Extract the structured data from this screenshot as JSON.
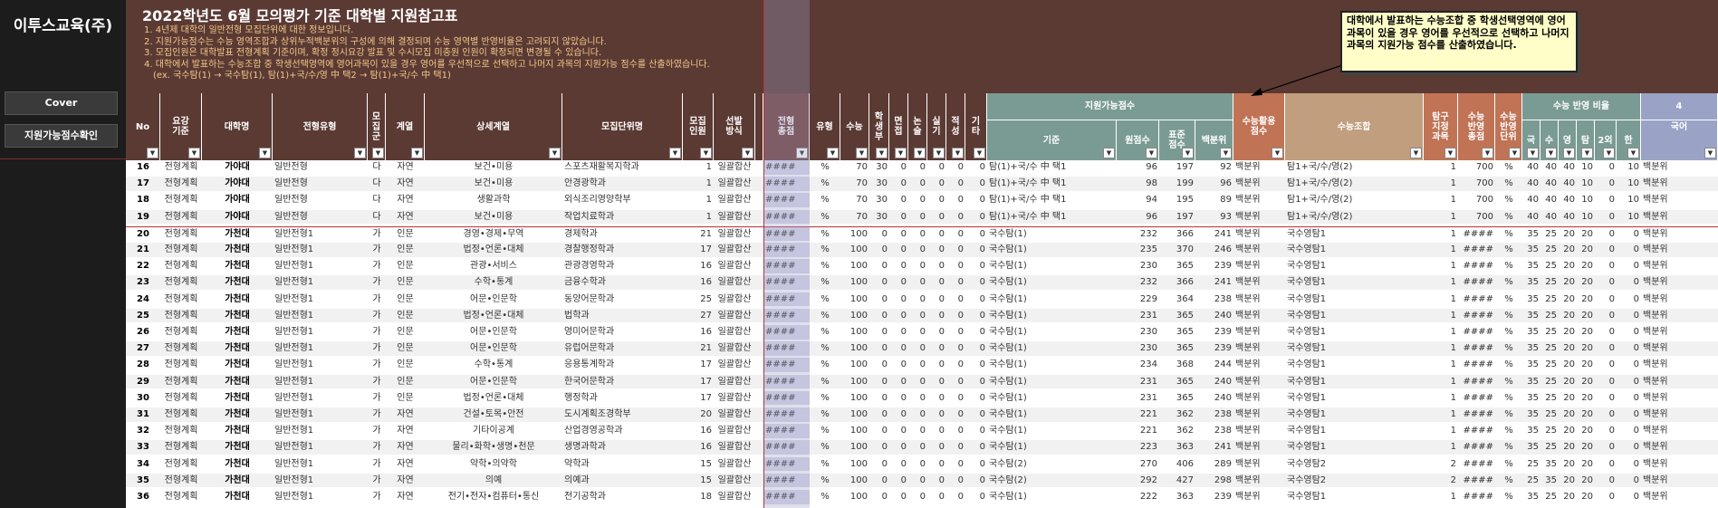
{
  "sidebar": {
    "brand": "이투스교육(주)",
    "cover_button": "Cover",
    "score_button": "지원가능점수확인"
  },
  "banner": {
    "title": "2022학년도 6월 모의평가 기준 대학별 지원참고표",
    "notes": [
      "1. 4년제 대학의 일반전형 모집단위에 대한 정보입니다.",
      "2. 지원가능점수는 수능 영역조합과 상위누적백분위의 구성에 의해 결정되며 수능 영역별 반영비율은 고려되지 않았습니다.",
      "3. 모집인원은 대학발표 전형계획 기준이며, 확정 정시요강 발표 및 수시모집 미충원 인원이 확정되면 변경될 수 있습니다.",
      "4. 대학에서 발표하는 수능조합 중 학생선택영역에 영어과목이 있을 경우 영어를 우선적으로 선택하고 나머지 과목의 지원가능 점수를 산출하였습니다.",
      "(ex. 국수탐(1) → 국수탐(1), 탐(1)+국/수/영 中 택2 → 탐(1)+국/수 中 택1)"
    ]
  },
  "callout": {
    "text": "대학에서 발표하는 수능조합 중 학생선택영역에 영어과목이 있을 경우 영어를 우선적으로 선택하고 나머지 과목의 지원가능 점수를 산출하였습니다."
  },
  "groups": {
    "score": "지원가능점수",
    "ratio": "수능 반영 비율",
    "extra": "4"
  },
  "headers": {
    "no": "No",
    "guide": "요강\n기준",
    "univ": "대학명",
    "type": "전형유형",
    "gun": "모\n집\n군",
    "field": "계열",
    "detail": "상세계열",
    "unit": "모집단위명",
    "cnt": "모집\n인원",
    "sel": "선발\n방식",
    "total": "전형\n총점",
    "kind": "유형",
    "suneung": "수능",
    "school": "학\n생\n부",
    "interview": "면\n접",
    "essay": "논\n술",
    "practical": "실\n기",
    "aptitude": "적\n성",
    "etc": "기\n타",
    "basis": "기준",
    "raw": "원점수",
    "std": "표준\n점수",
    "pct": "백분위",
    "use": "수능활용\n점수",
    "combo": "수능조합",
    "tam": "탐구\n지정\n과목",
    "tot2": "수능\n반영\n총점",
    "unit2": "수능\n반영\n단위",
    "kor": "국",
    "math": "수",
    "eng": "영",
    "tamc": "탐",
    "sec": "2외",
    "hist": "한",
    "k2": "국어"
  },
  "rows": [
    {
      "no": "16",
      "guide": "전형계획",
      "univ": "가야대",
      "type": "일반전형",
      "gun": "다",
      "field": "자연",
      "detail": "보건•미용",
      "unit": "스포츠재활복지학과",
      "cnt": "1",
      "sel": "일괄합산",
      "total": "####",
      "kind": "%",
      "sun": "70",
      "sch": "30",
      "iv": "0",
      "es": "0",
      "pr": "0",
      "ap": "0",
      "et": "0",
      "basis": "탐(1)+국/수 中 택1",
      "raw": "96",
      "std": "197",
      "pct": "92",
      "use": "백분위",
      "combo": "탐1+국/수/영(2)",
      "tam": "1",
      "tot2": "700",
      "unit2": "%",
      "kor": "40",
      "math": "40",
      "eng": "40",
      "tamc": "10",
      "sec": "0",
      "hist": "10",
      "k2": "백분위"
    },
    {
      "no": "17",
      "guide": "전형계획",
      "univ": "가야대",
      "type": "일반전형",
      "gun": "다",
      "field": "자연",
      "detail": "보건•미용",
      "unit": "안경광학과",
      "cnt": "1",
      "sel": "일괄합산",
      "total": "####",
      "kind": "%",
      "sun": "70",
      "sch": "30",
      "iv": "0",
      "es": "0",
      "pr": "0",
      "ap": "0",
      "et": "0",
      "basis": "탐(1)+국/수 中 택1",
      "raw": "98",
      "std": "199",
      "pct": "96",
      "use": "백분위",
      "combo": "탐1+국/수/영(2)",
      "tam": "1",
      "tot2": "700",
      "unit2": "%",
      "kor": "40",
      "math": "40",
      "eng": "40",
      "tamc": "10",
      "sec": "0",
      "hist": "10",
      "k2": "백분위"
    },
    {
      "no": "18",
      "guide": "전형계획",
      "univ": "가야대",
      "type": "일반전형",
      "gun": "다",
      "field": "자연",
      "detail": "생활과학",
      "unit": "외식조리영양학부",
      "cnt": "1",
      "sel": "일괄합산",
      "total": "####",
      "kind": "%",
      "sun": "70",
      "sch": "30",
      "iv": "0",
      "es": "0",
      "pr": "0",
      "ap": "0",
      "et": "0",
      "basis": "탐(1)+국/수 中 택1",
      "raw": "94",
      "std": "195",
      "pct": "89",
      "use": "백분위",
      "combo": "탐1+국/수/영(2)",
      "tam": "1",
      "tot2": "700",
      "unit2": "%",
      "kor": "40",
      "math": "40",
      "eng": "40",
      "tamc": "10",
      "sec": "0",
      "hist": "10",
      "k2": "백분위"
    },
    {
      "no": "19",
      "guide": "전형계획",
      "univ": "가야대",
      "type": "일반전형",
      "gun": "다",
      "field": "자연",
      "detail": "보건•미용",
      "unit": "작업치료학과",
      "cnt": "1",
      "sel": "일괄합산",
      "total": "####",
      "kind": "%",
      "sun": "70",
      "sch": "30",
      "iv": "0",
      "es": "0",
      "pr": "0",
      "ap": "0",
      "et": "0",
      "basis": "탐(1)+국/수 中 택1",
      "raw": "96",
      "std": "197",
      "pct": "93",
      "use": "백분위",
      "combo": "탐1+국/수/영(2)",
      "tam": "1",
      "tot2": "700",
      "unit2": "%",
      "kor": "40",
      "math": "40",
      "eng": "40",
      "tamc": "10",
      "sec": "0",
      "hist": "10",
      "k2": "백분위"
    },
    {
      "no": "20",
      "guide": "전형계획",
      "univ": "가천대",
      "type": "일반전형1",
      "gun": "가",
      "field": "인문",
      "detail": "경영•경제•무역",
      "unit": "경제학과",
      "cnt": "21",
      "sel": "일괄합산",
      "total": "####",
      "kind": "%",
      "sun": "100",
      "sch": "0",
      "iv": "0",
      "es": "0",
      "pr": "0",
      "ap": "0",
      "et": "0",
      "basis": "국수탐(1)",
      "raw": "232",
      "std": "366",
      "pct": "241",
      "use": "백분위",
      "combo": "국수영탐1",
      "tam": "1",
      "tot2": "####",
      "unit2": "%",
      "kor": "35",
      "math": "25",
      "eng": "20",
      "tamc": "20",
      "sec": "0",
      "hist": "0",
      "k2": "백분위"
    },
    {
      "no": "21",
      "guide": "전형계획",
      "univ": "가천대",
      "type": "일반전형1",
      "gun": "가",
      "field": "인문",
      "detail": "법정•언론•대체",
      "unit": "경찰행정학과",
      "cnt": "17",
      "sel": "일괄합산",
      "total": "####",
      "kind": "%",
      "sun": "100",
      "sch": "0",
      "iv": "0",
      "es": "0",
      "pr": "0",
      "ap": "0",
      "et": "0",
      "basis": "국수탐(1)",
      "raw": "235",
      "std": "370",
      "pct": "246",
      "use": "백분위",
      "combo": "국수영탐1",
      "tam": "1",
      "tot2": "####",
      "unit2": "%",
      "kor": "35",
      "math": "25",
      "eng": "20",
      "tamc": "20",
      "sec": "0",
      "hist": "0",
      "k2": "백분위"
    },
    {
      "no": "22",
      "guide": "전형계획",
      "univ": "가천대",
      "type": "일반전형1",
      "gun": "가",
      "field": "인문",
      "detail": "관광•서비스",
      "unit": "관광경영학과",
      "cnt": "16",
      "sel": "일괄합산",
      "total": "####",
      "kind": "%",
      "sun": "100",
      "sch": "0",
      "iv": "0",
      "es": "0",
      "pr": "0",
      "ap": "0",
      "et": "0",
      "basis": "국수탐(1)",
      "raw": "230",
      "std": "365",
      "pct": "239",
      "use": "백분위",
      "combo": "국수영탐1",
      "tam": "1",
      "tot2": "####",
      "unit2": "%",
      "kor": "35",
      "math": "25",
      "eng": "20",
      "tamc": "20",
      "sec": "0",
      "hist": "0",
      "k2": "백분위"
    },
    {
      "no": "23",
      "guide": "전형계획",
      "univ": "가천대",
      "type": "일반전형1",
      "gun": "가",
      "field": "인문",
      "detail": "수학•통계",
      "unit": "금융수학과",
      "cnt": "16",
      "sel": "일괄합산",
      "total": "####",
      "kind": "%",
      "sun": "100",
      "sch": "0",
      "iv": "0",
      "es": "0",
      "pr": "0",
      "ap": "0",
      "et": "0",
      "basis": "국수탐(1)",
      "raw": "232",
      "std": "366",
      "pct": "241",
      "use": "백분위",
      "combo": "국수영탐1",
      "tam": "1",
      "tot2": "####",
      "unit2": "%",
      "kor": "35",
      "math": "25",
      "eng": "20",
      "tamc": "20",
      "sec": "0",
      "hist": "0",
      "k2": "백분위"
    },
    {
      "no": "24",
      "guide": "전형계획",
      "univ": "가천대",
      "type": "일반전형1",
      "gun": "가",
      "field": "인문",
      "detail": "어문•인문학",
      "unit": "동양어문학과",
      "cnt": "25",
      "sel": "일괄합산",
      "total": "####",
      "kind": "%",
      "sun": "100",
      "sch": "0",
      "iv": "0",
      "es": "0",
      "pr": "0",
      "ap": "0",
      "et": "0",
      "basis": "국수탐(1)",
      "raw": "229",
      "std": "364",
      "pct": "238",
      "use": "백분위",
      "combo": "국수영탐1",
      "tam": "1",
      "tot2": "####",
      "unit2": "%",
      "kor": "35",
      "math": "25",
      "eng": "20",
      "tamc": "20",
      "sec": "0",
      "hist": "0",
      "k2": "백분위"
    },
    {
      "no": "25",
      "guide": "전형계획",
      "univ": "가천대",
      "type": "일반전형1",
      "gun": "가",
      "field": "인문",
      "detail": "법정•언론•대체",
      "unit": "법학과",
      "cnt": "27",
      "sel": "일괄합산",
      "total": "####",
      "kind": "%",
      "sun": "100",
      "sch": "0",
      "iv": "0",
      "es": "0",
      "pr": "0",
      "ap": "0",
      "et": "0",
      "basis": "국수탐(1)",
      "raw": "231",
      "std": "365",
      "pct": "240",
      "use": "백분위",
      "combo": "국수영탐1",
      "tam": "1",
      "tot2": "####",
      "unit2": "%",
      "kor": "35",
      "math": "25",
      "eng": "20",
      "tamc": "20",
      "sec": "0",
      "hist": "0",
      "k2": "백분위"
    },
    {
      "no": "26",
      "guide": "전형계획",
      "univ": "가천대",
      "type": "일반전형1",
      "gun": "가",
      "field": "인문",
      "detail": "어문•인문학",
      "unit": "영미어문학과",
      "cnt": "16",
      "sel": "일괄합산",
      "total": "####",
      "kind": "%",
      "sun": "100",
      "sch": "0",
      "iv": "0",
      "es": "0",
      "pr": "0",
      "ap": "0",
      "et": "0",
      "basis": "국수탐(1)",
      "raw": "230",
      "std": "365",
      "pct": "239",
      "use": "백분위",
      "combo": "국수영탐1",
      "tam": "1",
      "tot2": "####",
      "unit2": "%",
      "kor": "35",
      "math": "25",
      "eng": "20",
      "tamc": "20",
      "sec": "0",
      "hist": "0",
      "k2": "백분위"
    },
    {
      "no": "27",
      "guide": "전형계획",
      "univ": "가천대",
      "type": "일반전형1",
      "gun": "가",
      "field": "인문",
      "detail": "어문•인문학",
      "unit": "유럽어문학과",
      "cnt": "21",
      "sel": "일괄합산",
      "total": "####",
      "kind": "%",
      "sun": "100",
      "sch": "0",
      "iv": "0",
      "es": "0",
      "pr": "0",
      "ap": "0",
      "et": "0",
      "basis": "국수탐(1)",
      "raw": "230",
      "std": "365",
      "pct": "239",
      "use": "백분위",
      "combo": "국수영탐1",
      "tam": "1",
      "tot2": "####",
      "unit2": "%",
      "kor": "35",
      "math": "25",
      "eng": "20",
      "tamc": "20",
      "sec": "0",
      "hist": "0",
      "k2": "백분위"
    },
    {
      "no": "28",
      "guide": "전형계획",
      "univ": "가천대",
      "type": "일반전형1",
      "gun": "가",
      "field": "인문",
      "detail": "수학•통계",
      "unit": "응용통계학과",
      "cnt": "17",
      "sel": "일괄합산",
      "total": "####",
      "kind": "%",
      "sun": "100",
      "sch": "0",
      "iv": "0",
      "es": "0",
      "pr": "0",
      "ap": "0",
      "et": "0",
      "basis": "국수탐(1)",
      "raw": "234",
      "std": "368",
      "pct": "244",
      "use": "백분위",
      "combo": "국수영탐1",
      "tam": "1",
      "tot2": "####",
      "unit2": "%",
      "kor": "35",
      "math": "25",
      "eng": "20",
      "tamc": "20",
      "sec": "0",
      "hist": "0",
      "k2": "백분위"
    },
    {
      "no": "29",
      "guide": "전형계획",
      "univ": "가천대",
      "type": "일반전형1",
      "gun": "가",
      "field": "인문",
      "detail": "어문•인문학",
      "unit": "한국어문학과",
      "cnt": "17",
      "sel": "일괄합산",
      "total": "####",
      "kind": "%",
      "sun": "100",
      "sch": "0",
      "iv": "0",
      "es": "0",
      "pr": "0",
      "ap": "0",
      "et": "0",
      "basis": "국수탐(1)",
      "raw": "231",
      "std": "365",
      "pct": "240",
      "use": "백분위",
      "combo": "국수영탐1",
      "tam": "1",
      "tot2": "####",
      "unit2": "%",
      "kor": "35",
      "math": "25",
      "eng": "20",
      "tamc": "20",
      "sec": "0",
      "hist": "0",
      "k2": "백분위"
    },
    {
      "no": "30",
      "guide": "전형계획",
      "univ": "가천대",
      "type": "일반전형1",
      "gun": "가",
      "field": "인문",
      "detail": "법정•언론•대체",
      "unit": "행정학과",
      "cnt": "17",
      "sel": "일괄합산",
      "total": "####",
      "kind": "%",
      "sun": "100",
      "sch": "0",
      "iv": "0",
      "es": "0",
      "pr": "0",
      "ap": "0",
      "et": "0",
      "basis": "국수탐(1)",
      "raw": "231",
      "std": "365",
      "pct": "240",
      "use": "백분위",
      "combo": "국수영탐1",
      "tam": "1",
      "tot2": "####",
      "unit2": "%",
      "kor": "35",
      "math": "25",
      "eng": "20",
      "tamc": "20",
      "sec": "0",
      "hist": "0",
      "k2": "백분위"
    },
    {
      "no": "31",
      "guide": "전형계획",
      "univ": "가천대",
      "type": "일반전형1",
      "gun": "가",
      "field": "자연",
      "detail": "건설•토목•안전",
      "unit": "도시계획조경학부",
      "cnt": "20",
      "sel": "일괄합산",
      "total": "####",
      "kind": "%",
      "sun": "100",
      "sch": "0",
      "iv": "0",
      "es": "0",
      "pr": "0",
      "ap": "0",
      "et": "0",
      "basis": "국수탐(1)",
      "raw": "221",
      "std": "362",
      "pct": "238",
      "use": "백분위",
      "combo": "국수영탐1",
      "tam": "1",
      "tot2": "####",
      "unit2": "%",
      "kor": "35",
      "math": "25",
      "eng": "20",
      "tamc": "20",
      "sec": "0",
      "hist": "0",
      "k2": "백분위"
    },
    {
      "no": "32",
      "guide": "전형계획",
      "univ": "가천대",
      "type": "일반전형1",
      "gun": "가",
      "field": "자연",
      "detail": "기타이공계",
      "unit": "산업경영공학과",
      "cnt": "16",
      "sel": "일괄합산",
      "total": "####",
      "kind": "%",
      "sun": "100",
      "sch": "0",
      "iv": "0",
      "es": "0",
      "pr": "0",
      "ap": "0",
      "et": "0",
      "basis": "국수탐(1)",
      "raw": "221",
      "std": "362",
      "pct": "238",
      "use": "백분위",
      "combo": "국수영탐1",
      "tam": "1",
      "tot2": "####",
      "unit2": "%",
      "kor": "35",
      "math": "25",
      "eng": "20",
      "tamc": "20",
      "sec": "0",
      "hist": "0",
      "k2": "백분위"
    },
    {
      "no": "33",
      "guide": "전형계획",
      "univ": "가천대",
      "type": "일반전형1",
      "gun": "가",
      "field": "자연",
      "detail": "물리•화학•생명•천문",
      "unit": "생명과학과",
      "cnt": "16",
      "sel": "일괄합산",
      "total": "####",
      "kind": "%",
      "sun": "100",
      "sch": "0",
      "iv": "0",
      "es": "0",
      "pr": "0",
      "ap": "0",
      "et": "0",
      "basis": "국수탐(1)",
      "raw": "223",
      "std": "363",
      "pct": "241",
      "use": "백분위",
      "combo": "국수영탐1",
      "tam": "1",
      "tot2": "####",
      "unit2": "%",
      "kor": "35",
      "math": "25",
      "eng": "20",
      "tamc": "20",
      "sec": "0",
      "hist": "0",
      "k2": "백분위"
    },
    {
      "no": "34",
      "guide": "전형계획",
      "univ": "가천대",
      "type": "일반전형1",
      "gun": "가",
      "field": "자연",
      "detail": "약학•의약학",
      "unit": "약학과",
      "cnt": "15",
      "sel": "일괄합산",
      "total": "####",
      "kind": "%",
      "sun": "100",
      "sch": "0",
      "iv": "0",
      "es": "0",
      "pr": "0",
      "ap": "0",
      "et": "0",
      "basis": "국수탐(2)",
      "raw": "270",
      "std": "406",
      "pct": "289",
      "use": "백분위",
      "combo": "국수영탐2",
      "tam": "2",
      "tot2": "####",
      "unit2": "%",
      "kor": "25",
      "math": "35",
      "eng": "20",
      "tamc": "20",
      "sec": "0",
      "hist": "0",
      "k2": "백분위"
    },
    {
      "no": "35",
      "guide": "전형계획",
      "univ": "가천대",
      "type": "일반전형1",
      "gun": "가",
      "field": "자연",
      "detail": "의예",
      "unit": "의예과",
      "cnt": "15",
      "sel": "일괄합산",
      "total": "####",
      "kind": "%",
      "sun": "100",
      "sch": "0",
      "iv": "0",
      "es": "0",
      "pr": "0",
      "ap": "0",
      "et": "0",
      "basis": "국수탐(2)",
      "raw": "292",
      "std": "427",
      "pct": "298",
      "use": "백분위",
      "combo": "국수영탐2",
      "tam": "2",
      "tot2": "####",
      "unit2": "%",
      "kor": "25",
      "math": "35",
      "eng": "20",
      "tamc": "20",
      "sec": "0",
      "hist": "0",
      "k2": "백분위"
    },
    {
      "no": "36",
      "guide": "전형계획",
      "univ": "가천대",
      "type": "일반전형1",
      "gun": "가",
      "field": "자연",
      "detail": "전기•전자•컴퓨터•통신",
      "unit": "전기공학과",
      "cnt": "18",
      "sel": "일괄합산",
      "total": "####",
      "kind": "%",
      "sun": "100",
      "sch": "0",
      "iv": "0",
      "es": "0",
      "pr": "0",
      "ap": "0",
      "et": "0",
      "basis": "국수탐(1)",
      "raw": "222",
      "std": "363",
      "pct": "239",
      "use": "백분위",
      "combo": "국수영탐1",
      "tam": "1",
      "tot2": "####",
      "unit2": "%",
      "kor": "35",
      "math": "25",
      "eng": "20",
      "tamc": "20",
      "sec": "0",
      "hist": "0",
      "k2": "백분위"
    }
  ]
}
